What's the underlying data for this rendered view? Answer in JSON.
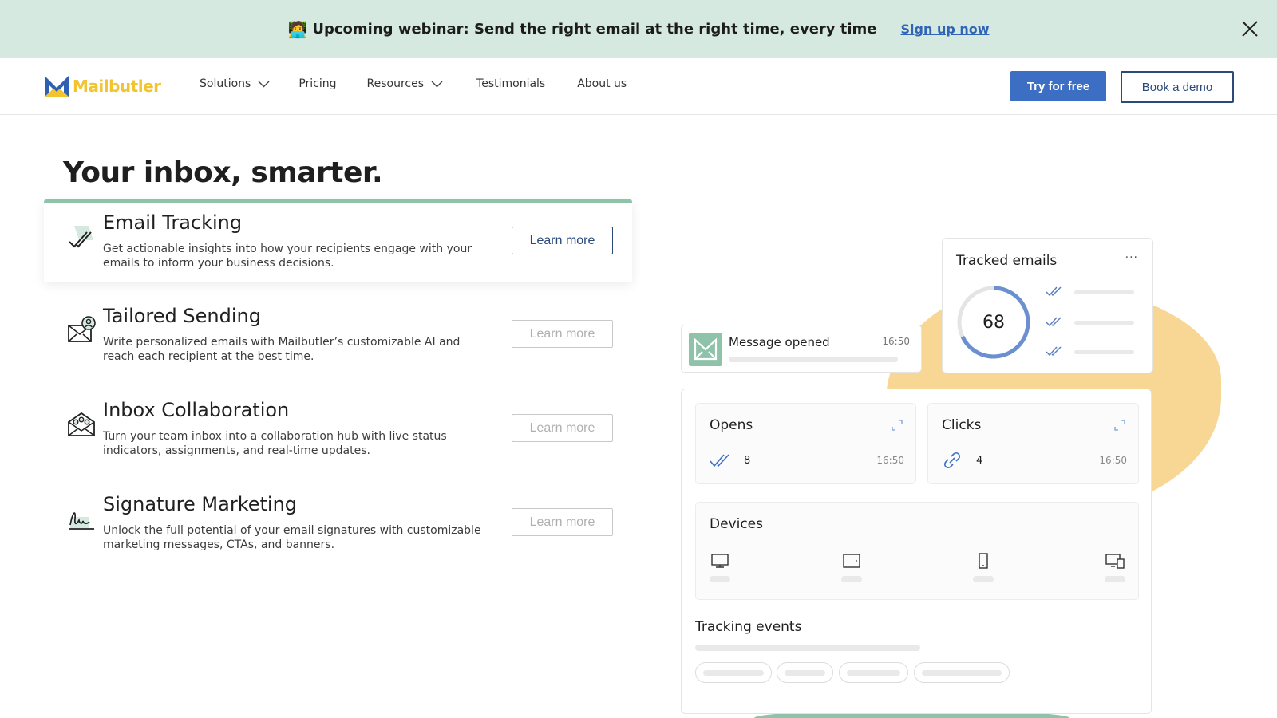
{
  "banner": {
    "emoji": "🧑‍💻",
    "text": "Upcoming webinar: Send the right email at the right time, every time",
    "link": "Sign up now"
  },
  "nav": {
    "logo": "Mailbutler",
    "items": {
      "solutions": "Solutions",
      "pricing": "Pricing",
      "resources": "Resources",
      "testimonials": "Testimonials",
      "about": "About us"
    },
    "try_label": "Try for free",
    "demo_label": "Book a demo"
  },
  "hero": {
    "title": "Your inbox, smarter.",
    "features": [
      {
        "title": "Email Tracking",
        "description": "Get actionable insights into how your recipients engage with your emails to inform your business decisions.",
        "cta": "Learn more"
      },
      {
        "title": "Tailored Sending",
        "description": "Write personalized emails with Mailbutler’s customizable AI and reach each recipient at the best time.",
        "cta": "Learn more"
      },
      {
        "title": "Inbox Collaboration",
        "description": "Turn your team inbox into a collaboration hub with live status indicators, assignments, and real-time updates.",
        "cta": "Learn more"
      },
      {
        "title": "Signature Marketing",
        "description": "Unlock the full potential of your email signatures with customizable marketing messages, CTAs, and banners.",
        "cta": "Learn more"
      }
    ]
  },
  "illustration": {
    "tracked": {
      "title": "Tracked emails",
      "menu": "···",
      "value": "68"
    },
    "message": {
      "title": "Message opened",
      "time": "16:50"
    },
    "opens": {
      "title": "Opens",
      "count": "8",
      "time": "16:50"
    },
    "clicks": {
      "title": "Clicks",
      "count": "4",
      "time": "16:50"
    },
    "devices": {
      "title": "Devices"
    },
    "events": {
      "title": "Tracking events"
    }
  },
  "colors": {
    "banner_bg": "#d5e9e1",
    "primary": "#3c6fc4",
    "accent_green": "#8ec3aa",
    "accent_yellow": "#f8d794",
    "logo_yellow": "#f2c530",
    "logo_blue": "#2f5fb3"
  }
}
